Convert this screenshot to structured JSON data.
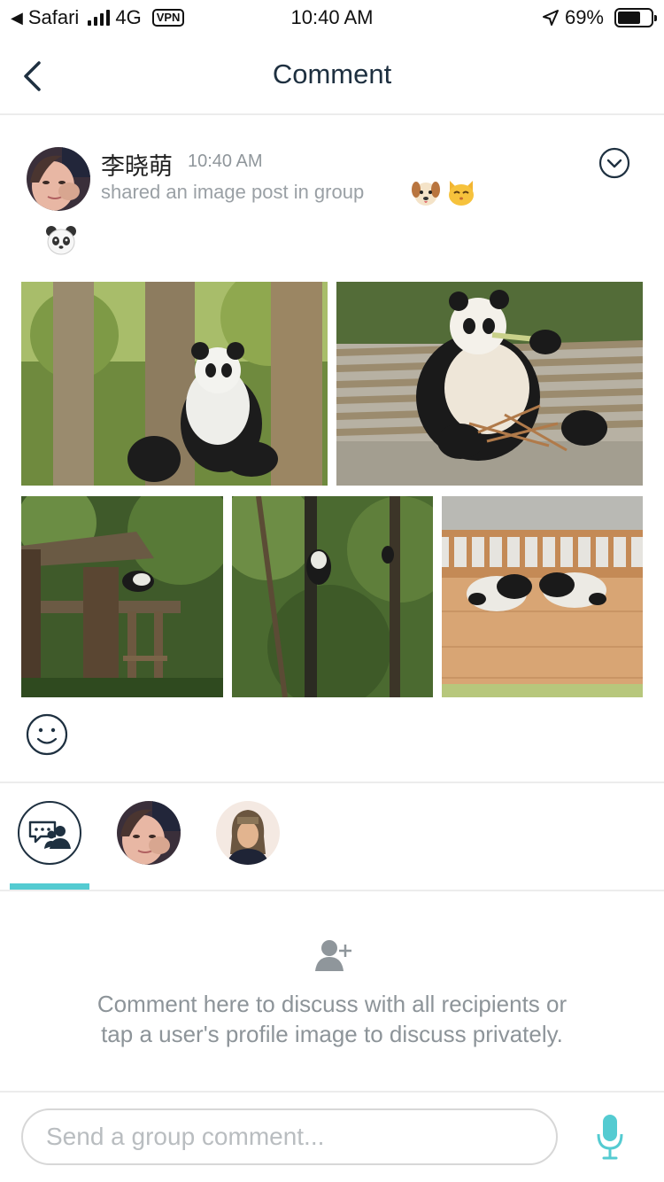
{
  "status_bar": {
    "back_app": "Safari",
    "network": "4G",
    "vpn": "VPN",
    "time": "10:40 AM",
    "battery": "69%",
    "battery_level": 0.69
  },
  "nav": {
    "title": "Comment",
    "back_icon": "chevron-left-icon"
  },
  "post": {
    "author": "李晓萌",
    "time": "10:40 AM",
    "shared_text": "shared an image post in group",
    "group_emojis": [
      "dog-face-emoji",
      "cat-face-emoji",
      "panda-face-emoji"
    ],
    "more_icon": "chevron-down-circle-icon",
    "photos": [
      "panda-in-tree",
      "panda-eating-bamboo",
      "wooden-platform-in-forest",
      "panda-climbing-tree",
      "panda-cubs-sleeping"
    ],
    "reaction_icon": "smiley-icon"
  },
  "recipients": {
    "tabs": [
      "group-chat-icon",
      "user-avatar-1",
      "user-avatar-2"
    ],
    "active_color": "#54cbd1"
  },
  "empty_state": {
    "icon": "add-user-icon",
    "message": "Comment here to discuss with all recipients or tap a user's profile image to discuss privately."
  },
  "composer": {
    "placeholder": "Send a group comment...",
    "mic_icon": "microphone-icon"
  }
}
